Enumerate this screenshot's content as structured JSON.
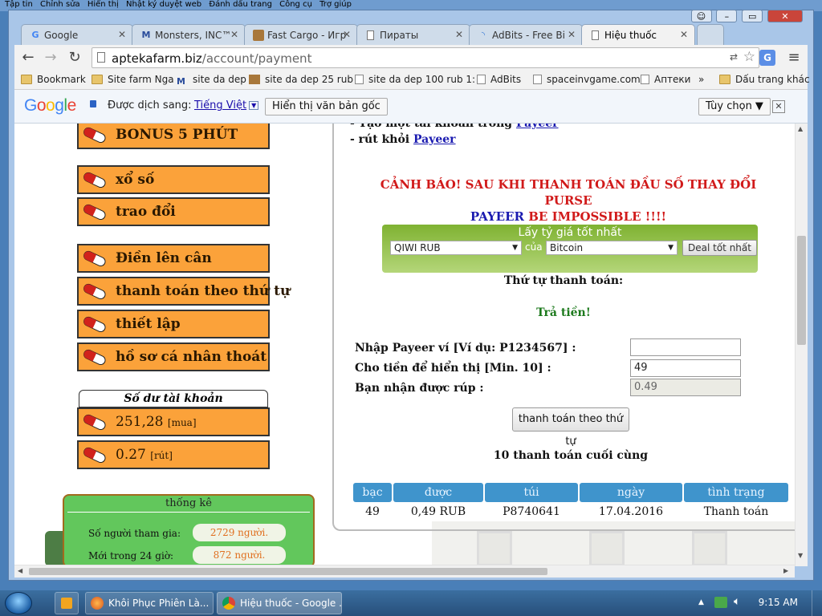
{
  "menubar": [
    "Tập tin",
    "Chỉnh sửa",
    "Hiển thị",
    "Nhật ký duyệt web",
    "Đánh dấu trang",
    "Công cụ",
    "Trợ giúp"
  ],
  "tabs": [
    {
      "label": "Google",
      "icon": "google-icon"
    },
    {
      "label": "Monsters, INC™",
      "icon": "monsters-icon"
    },
    {
      "label": "Fast Cargo - Игр",
      "icon": "box-icon"
    },
    {
      "label": "Пираты",
      "icon": "page-icon"
    },
    {
      "label": "AdBits - Free Bi",
      "icon": "loading-icon"
    },
    {
      "label": "Hiệu thuốc",
      "icon": "page-icon"
    }
  ],
  "address": {
    "host": "aptekafarm.biz",
    "path": "/account/payment"
  },
  "bookmarks": [
    {
      "label": "Bookmark",
      "icon": "folder"
    },
    {
      "label": "Site farm Nga",
      "icon": "folder"
    },
    {
      "label": "site da dep",
      "icon": "monsters"
    },
    {
      "label": "site da dep 25 rub",
      "icon": "box"
    },
    {
      "label": "site da dep 100 rub 1:",
      "icon": "page"
    },
    {
      "label": "AdBits",
      "icon": "page"
    },
    {
      "label": "spaceinvgame.com",
      "icon": "page"
    },
    {
      "label": "Аптеки",
      "icon": "page"
    },
    {
      "label": "»",
      "icon": ""
    },
    {
      "label": "Dấu trang khác",
      "icon": "folder"
    }
  ],
  "translate": {
    "google": "Google",
    "translated_to": "Được dịch sang:",
    "language": "Tiếng Việt",
    "show_original": "Hiển thị văn bản gốc",
    "options": "Tùy chọn ▼"
  },
  "menu": [
    {
      "label": "BONUS 5 PHÚT"
    },
    {
      "label": "xổ số"
    },
    {
      "label": "trao đổi"
    },
    {
      "label": "Điền lên cân"
    },
    {
      "label": "thanh toán theo thứ tự"
    },
    {
      "label": "thiết lập"
    },
    {
      "label": "hồ sơ cá nhân thoát"
    }
  ],
  "balance": {
    "title": "Số dư tài khoản",
    "buy_value": "251,28",
    "buy_label": "[mua]",
    "withdraw_value": "0.27",
    "withdraw_label": "[rút]"
  },
  "stats": {
    "title": "thống kê",
    "members_label": "Số người tham gia:",
    "members_value": "2729 người.",
    "new24_label": "Mới trong 24 giờ:",
    "new24_value": "872 người."
  },
  "instructions": {
    "line1_prefix": "- Tạo một tài khoản trong ",
    "line1_link": "Payeer",
    "line2_prefix": "- rút khỏi ",
    "line2_link": "Payeer"
  },
  "warning": {
    "red1": "CẢNH BÁO! SAU KHI THANH TOÁN ĐẦU SỐ THAY ĐỔI PURSE",
    "blue": "PAYEER",
    "red2": " BE IMPOSSIBLE !!!!"
  },
  "rate": {
    "title": "Lấy tỷ giá tốt nhất",
    "from": "QIWI RUB",
    "of": "của",
    "to": "Bitcoin",
    "button": "Deal tốt nhất"
  },
  "order_title": "Thứ tự thanh toán:",
  "pay_title": "Trả tiền!",
  "form": {
    "wallet_label": "Nhập Payeer ví [Ví dụ: P1234567] :",
    "wallet_value": "",
    "amount_label": "Cho tiền để hiển thị [Min. 10] :",
    "amount_value": "49",
    "receive_label": "Bạn nhận được rúp :",
    "receive_value": "0.49",
    "submit": "thanh toán theo thứ tự"
  },
  "history": {
    "title": "10 thanh toán cuối cùng",
    "columns": [
      "bạc",
      "được",
      "túi",
      "ngày",
      "tình trạng"
    ],
    "rows": [
      [
        "49",
        "0,49 RUB",
        "P8740641",
        "17.04.2016",
        "Thanh toán"
      ]
    ]
  },
  "taskbar": {
    "items": [
      "Khôi Phục Phiên Là...",
      "Hiệu thuốc - Google ..."
    ],
    "clock": "9:15 AM"
  },
  "colors": {
    "menu_orange": "#fba23a",
    "warning_red": "#d11a1a",
    "payeer_blue": "#1a1ab0",
    "table_header": "#3f94cc",
    "stats_green": "#62c75c"
  }
}
